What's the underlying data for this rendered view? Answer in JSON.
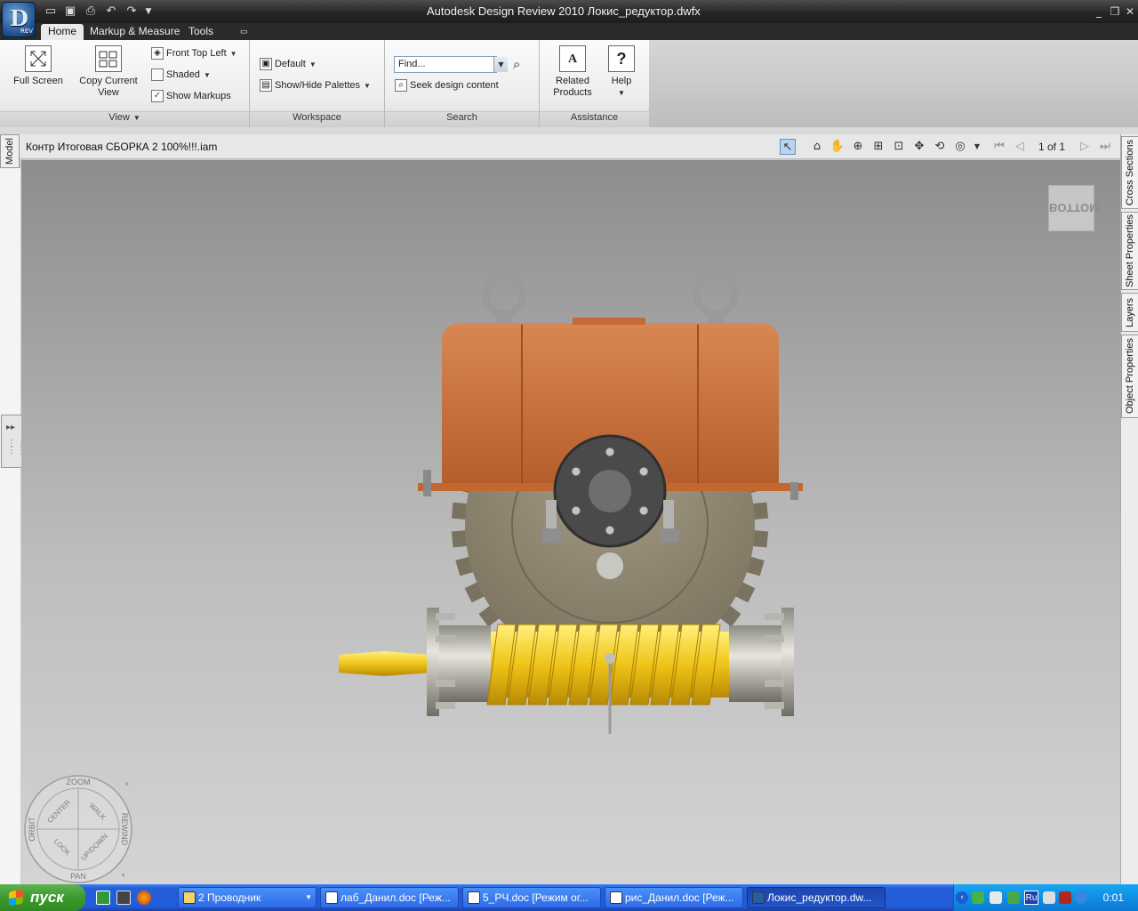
{
  "window": {
    "title": "Autodesk Design Review 2010   Локис_редуктор.dwfx",
    "app_badge": "REV"
  },
  "tabs": [
    "Home",
    "Markup & Measure",
    "Tools"
  ],
  "ribbon": {
    "view": {
      "title": "View",
      "full_screen": "Full Screen",
      "copy_view_line1": "Copy Current",
      "copy_view_line2": "View",
      "front_top_left": "Front Top Left",
      "shaded": "Shaded",
      "show_markups": "Show Markups"
    },
    "workspace": {
      "title": "Workspace",
      "default": "Default",
      "show_hide": "Show/Hide Palettes"
    },
    "search": {
      "title": "Search",
      "find_value": "Find...",
      "seek": "Seek design content"
    },
    "assistance": {
      "title": "Assistance",
      "related_line1": "Related",
      "related_line2": "Products",
      "help": "Help"
    }
  },
  "document": {
    "name": "Контр Итоговая СБОРКА 2 100%!!!.iam",
    "page": "1 of 1"
  },
  "side_tabs": {
    "left": "Model",
    "right": [
      "Cross Sections",
      "Sheet Properties",
      "Layers",
      "Object Properties"
    ]
  },
  "viewcube_label": "BOTTOM",
  "nav_wheel": {
    "zoom": "ZOOM",
    "rewind": "REWIND",
    "pan": "PAN",
    "orbit": "ORBIT",
    "center": "CENTER",
    "walk": "WALK",
    "look": "LOOK",
    "updown": "UP/DOWN"
  },
  "taskbar": {
    "start": "пуск",
    "tasks": [
      "2 Проводник",
      "лаб_Данил.doc [Реж...",
      "5_РЧ.doc [Режим ог...",
      "рис_Данил.doc [Реж...",
      "Локис_редуктор.dw..."
    ],
    "clock": "0:01",
    "lang": "Ru"
  },
  "colors": {
    "housing": "#c8703a",
    "gear": "#8a826c",
    "worm": "#f0c418",
    "xp_blue": "#245edb"
  }
}
